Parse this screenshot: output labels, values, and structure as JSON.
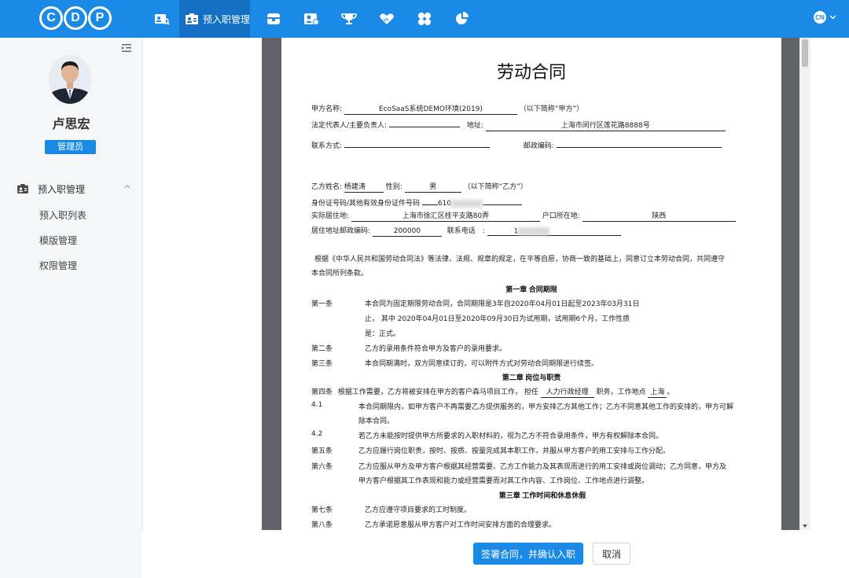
{
  "header": {
    "logo_letters": [
      "C",
      "D",
      "P"
    ],
    "nav": [
      {
        "icon": "id-card-search-icon"
      },
      {
        "icon": "id-card-icon",
        "label": "预入职管理",
        "active": true
      },
      {
        "icon": "box-icon"
      },
      {
        "icon": "user-card-icon"
      },
      {
        "icon": "trophy-icon"
      },
      {
        "icon": "handshake-icon"
      },
      {
        "icon": "clover-icon"
      },
      {
        "icon": "pie-chart-icon"
      }
    ],
    "lang": "CN"
  },
  "sidebar": {
    "user_name": "卢思宏",
    "role": "管理员",
    "menu_group": "预入职管理",
    "menu_items": [
      "预入职列表",
      "模版管理",
      "权限管理"
    ]
  },
  "doc": {
    "title": "劳动合同",
    "party_a": {
      "name_label": "甲方名称:",
      "name_value": "EcoSaaS系统DEMO环境(2019)",
      "name_suffix": "（以下简称“甲方”）",
      "rep_label": "法定代表人/主要负责人:",
      "address_label": "地址:",
      "address_value": "上海市闵行区莲花路8888号",
      "contact_label": "联系方式:",
      "postcode_label": "邮政编码:"
    },
    "party_b": {
      "name_label": "乙方姓名:",
      "name_value": "杨建涛",
      "gender_label": "性别:",
      "gender_value": "男",
      "name_suffix": "（以下简称“乙方”）",
      "id_label": "身份证号码/其他有效身份证件号码",
      "id_value": "610",
      "residence_label": "实际居住地:",
      "residence_value": "上海市徐汇区桂平支路80弄",
      "hukou_label": "户口所在地:",
      "hukou_value": "陕西",
      "postcode_label": "居住地址邮政编码:",
      "postcode_value": "200000",
      "phone_label": "联系电话",
      "phone_value": "1"
    },
    "preamble_1": "根据《中华人民共和国劳动合同法》等法律、法规、规章的规定，在平等自愿，协商一致的基础上，同意订立本劳动合同，共同遵守",
    "preamble_2": "本合同所列条款。",
    "chapter1": "第一章  合同期限",
    "art1_num": "第一条",
    "art1_l1": "本合同为固定期限劳动合同，合同期限是3年自2020年04月01日起至2023年03月31日",
    "art1_l2": "止，  其中  2020年04月01日至2020年09月30日为试用期，试用期6个月，工作性质",
    "art1_l3": "是：正式。",
    "art2_num": "第二条",
    "art2": "乙方的录用条件符合甲方及客户的录用要求。",
    "art3_num": "第三条",
    "art3": "本合同期满时，双方同意续订的，可以附件方式对劳动合同期限进行续签。",
    "chapter2": "第二章  岗位与职责",
    "art4_num": "第四条",
    "art4_pre": "根据工作需要，乙方将被安排在甲方的客户森马项目工作，  担任",
    "art4_post": "人力行政经理",
    "art4_mid": "职务，工作地点",
    "art4_place": "上海",
    "art4_end": "。",
    "s41_num": "4.1",
    "s41_l1": "本合同期限内，如甲方客户不再需要乙方提供服务的，甲方安排乙方其他工作；乙方不同意其他工作的安排的，甲方可解",
    "s41_l2": "除本合同。",
    "s42_num": "4.2",
    "s42": "若乙方未能按时提供甲方所要求的入职材料的，视为乙方不符合录用条件，甲方有权解除本合同。",
    "art5_num": "第五条",
    "art5": "乙方应履行岗位职责，按时、按质、按量完成其本职工作，并服从甲方客户的用工安排与工作分配。",
    "art6_num": "第六条",
    "art6_l1": "乙方应服从甲方及甲方客户根据其经营需要、乙方工作能力及其表现而进行的用工安排或岗位调动；乙方同意，甲方及",
    "art6_l2": "甲方客户根据其工作表现和能力或经营需要而对其工作内容、工作岗位、工作地点进行调整。",
    "chapter3": "第三章  工作时间和休息休假",
    "art7_num": "第七条",
    "art7": "乙方应遵守项目要求的工时制度。",
    "art8_num": "第八条",
    "art8": "乙方承诺愿意服从甲方客户对工作时间安排方面的合理要求。"
  },
  "footer": {
    "confirm_label": "签署合同，并确认入职",
    "cancel_label": "取消"
  }
}
